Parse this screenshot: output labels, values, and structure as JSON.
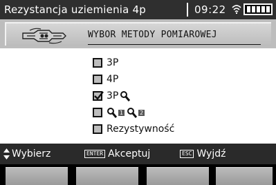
{
  "statusbar": {
    "title": "Rezystancja uziemienia 4p",
    "time": "09:22",
    "wifi_icon": "wifi-icon",
    "battery_icon": "battery-full-icon"
  },
  "header": {
    "icon": "test-leads-plug-icon",
    "title": "WYBOR METODY POMIAROWEJ"
  },
  "options": [
    {
      "label": "3P",
      "checked": false,
      "icons": []
    },
    {
      "label": "4P",
      "checked": false,
      "icons": []
    },
    {
      "label": "3P",
      "checked": true,
      "icons": [
        "clamp-icon"
      ]
    },
    {
      "label": "",
      "checked": false,
      "icons": [
        "clamp-icon-1",
        "clamp-icon-2"
      ],
      "badges": [
        "1",
        "2"
      ]
    },
    {
      "label": "Rezystywność",
      "checked": false,
      "icons": []
    }
  ],
  "hints": {
    "select_label": "Wybierz",
    "enter_key": "ENTER",
    "accept_label": "Akceptuj",
    "esc_key": "ESC",
    "exit_label": "Wyjdź"
  },
  "colors": {
    "bar_dark": "#2f2f2f",
    "header_gray": "#bdbdbd",
    "content_bg": "#ffffff",
    "softkey": "#aaaaaa"
  }
}
